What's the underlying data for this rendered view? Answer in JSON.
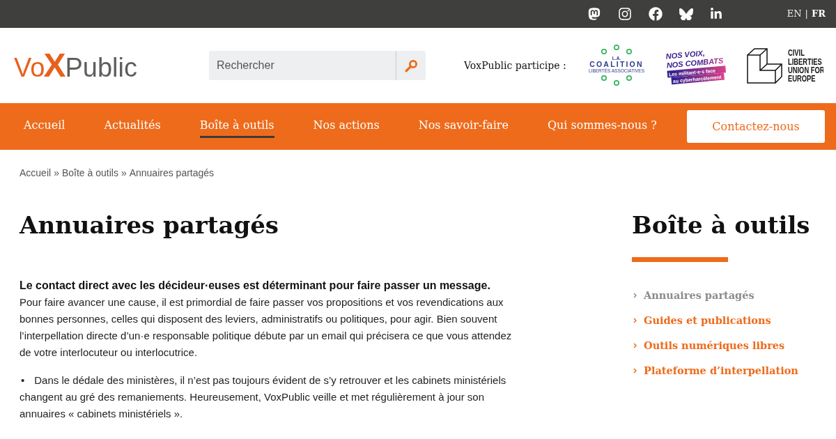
{
  "top_bar": {
    "languages": [
      {
        "label": "EN",
        "selected": false
      },
      {
        "label": "FR",
        "selected": true
      }
    ],
    "language_separator": "|"
  },
  "header": {
    "logo": {
      "start": "Vo",
      "mark": "X",
      "end": "Public"
    },
    "search": {
      "placeholder": "Rechercher"
    },
    "partners_label": "VoxPublic participe :",
    "partners": [
      {
        "kind": "coalition",
        "lines": [
          "L.A.",
          "COALITION",
          "LIBERTÉS ASSOCIATIVES"
        ]
      },
      {
        "kind": "nos_voix",
        "title_lines": [
          "NOS VOIX,",
          "NOS COMBATS"
        ],
        "band_lines": [
          "Les militant·e·s face",
          "au cyberharcèlement"
        ]
      },
      {
        "kind": "civil_liberties",
        "lines": [
          "CIVIL",
          "LIBERTIES",
          "UNION FOR",
          "EUROPE"
        ]
      }
    ]
  },
  "nav": {
    "items": [
      {
        "label": "Accueil",
        "selected": false
      },
      {
        "label": "Actualités",
        "selected": false
      },
      {
        "label": "Boîte à outils",
        "selected": true
      },
      {
        "label": "Nos actions",
        "selected": false
      },
      {
        "label": "Nos savoir-faire",
        "selected": false
      },
      {
        "label": "Qui sommes-nous ?",
        "selected": false
      }
    ],
    "cta": "Contactez-nous"
  },
  "breadcrumb": {
    "items": [
      "Accueil",
      "Boîte à outils",
      "Annuaires partagés"
    ],
    "separators": [
      "»",
      "»"
    ]
  },
  "article": {
    "title": "Annuaires partagés",
    "lead": "Le contact direct avec les décideur·euses est déterminant pour faire passer un message.",
    "paragraph": "Pour faire avancer une cause, il est primordial de faire passer vos propositions et vos revendications aux bonnes personnes, celles qui disposent des leviers, administratifs ou politiques, pour agir. Bien souvent l’interpellation directe d’un·e responsable politique débute par un email qui précisera ce que vous attendez de votre interlocuteur ou interlocutrice.",
    "list": [
      {
        "marker": "•",
        "text": "Dans le dédale des ministères, il n’est pas toujours évident de s’y retrouver et les cabinets ministériels changent au gré des remaniements. Heureusement, VoxPublic veille et met régulièrement à jour son annuaires « cabinets ministériels »."
      }
    ]
  },
  "sidebar": {
    "title": "Boîte à outils",
    "items": [
      {
        "label": "Annuaires partagés",
        "selected": true
      },
      {
        "label": "Guides et publications",
        "selected": false
      },
      {
        "label": "Outils numériques libres",
        "selected": false
      },
      {
        "label": "Plateforme d’interpellation",
        "selected": false
      }
    ]
  }
}
